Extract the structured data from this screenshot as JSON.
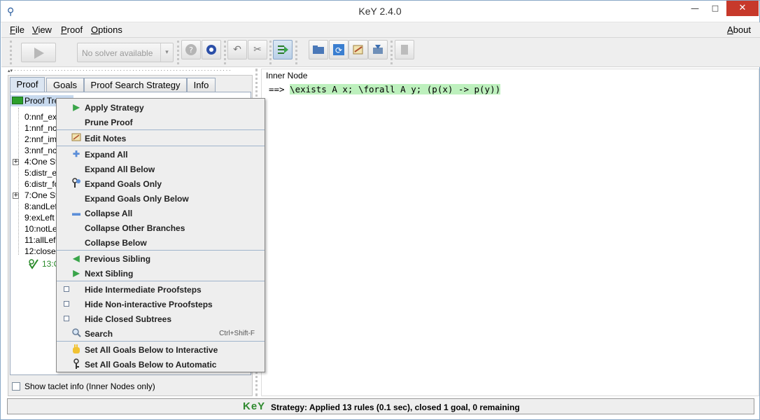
{
  "window": {
    "title": "KeY 2.4.0",
    "min_glyph": "—",
    "max_glyph": "□",
    "close_glyph": "✕",
    "app_icon_glyph": "⚲"
  },
  "menubar": {
    "items": [
      {
        "label": "File"
      },
      {
        "label": "View"
      },
      {
        "label": "Proof"
      },
      {
        "label": "Options"
      }
    ],
    "about": "About"
  },
  "toolbar": {
    "solver_label": "No solver available",
    "solver_arrow": "▾"
  },
  "left_panel": {
    "tabs": [
      {
        "label": "Proof",
        "selected": true
      },
      {
        "label": "Goals",
        "selected": false
      },
      {
        "label": "Proof Search Strategy",
        "selected": false
      },
      {
        "label": "Info",
        "selected": false
      }
    ],
    "tree": {
      "root_label": "Proof Tre",
      "nodes": [
        {
          "label": "0:nnf_ex",
          "expandable": false
        },
        {
          "label": "1:nnf_nc",
          "expandable": false
        },
        {
          "label": "2:nnf_im",
          "expandable": false
        },
        {
          "label": "3:nnf_nc",
          "expandable": false
        },
        {
          "label": "4:One St",
          "expandable": true
        },
        {
          "label": "5:distr_e",
          "expandable": false
        },
        {
          "label": "6:distr_fo",
          "expandable": false
        },
        {
          "label": "7:One St",
          "expandable": true
        },
        {
          "label": "8:andLef",
          "expandable": false
        },
        {
          "label": "9:exLeft",
          "expandable": false
        },
        {
          "label": "10:notLe",
          "expandable": false
        },
        {
          "label": "11:allLef",
          "expandable": false
        },
        {
          "label": "12:close",
          "expandable": false
        }
      ],
      "closed_goal_label": "13:C"
    },
    "taclet_checkbox": "Show taclet info (Inner Nodes only)"
  },
  "right_panel": {
    "title": "Inner Node",
    "sequent_arrow": "==>",
    "formula": "\\exists A x; \\forall A y; (p(x) -> p(y))"
  },
  "context_menu": {
    "items": [
      {
        "label": "Apply Strategy",
        "icon": "play-icon"
      },
      {
        "label": "Prune Proof",
        "icon": ""
      },
      {
        "label": "Edit Notes",
        "icon": "notes-icon"
      },
      {
        "label": "Expand All",
        "icon": "plus-icon"
      },
      {
        "label": "Expand All Below",
        "icon": ""
      },
      {
        "label": "Expand Goals Only",
        "icon": "goal-icon"
      },
      {
        "label": "Expand Goals Only Below",
        "icon": ""
      },
      {
        "label": "Collapse All",
        "icon": "minus-icon"
      },
      {
        "label": "Collapse Other Branches",
        "icon": ""
      },
      {
        "label": "Collapse Below",
        "icon": ""
      },
      {
        "label": "Previous Sibling",
        "icon": "arrow-left-icon"
      },
      {
        "label": "Next Sibling",
        "icon": "arrow-right-icon"
      },
      {
        "label": "Hide Intermediate Proofsteps",
        "icon": "checkbox-icon"
      },
      {
        "label": "Hide Non-interactive Proofsteps",
        "icon": "checkbox-icon"
      },
      {
        "label": "Hide Closed Subtrees",
        "icon": "checkbox-icon"
      },
      {
        "label": "Search",
        "icon": "search-icon",
        "shortcut": "Ctrl+Shift-F"
      },
      {
        "label": "Set All Goals Below to Interactive",
        "icon": "hand-icon"
      },
      {
        "label": "Set All Goals Below to Automatic",
        "icon": "key-icon"
      }
    ]
  },
  "statusbar": {
    "logo": "KeY",
    "text": "Strategy: Applied 13 rules (0.1 sec),  closed 1 goal, 0 remaining"
  },
  "colors": {
    "formula_highlight": "#bdf0bd",
    "selected_root": "#c7d9ee",
    "close_button": "#c7392b",
    "accent_green": "#2ca02c"
  }
}
